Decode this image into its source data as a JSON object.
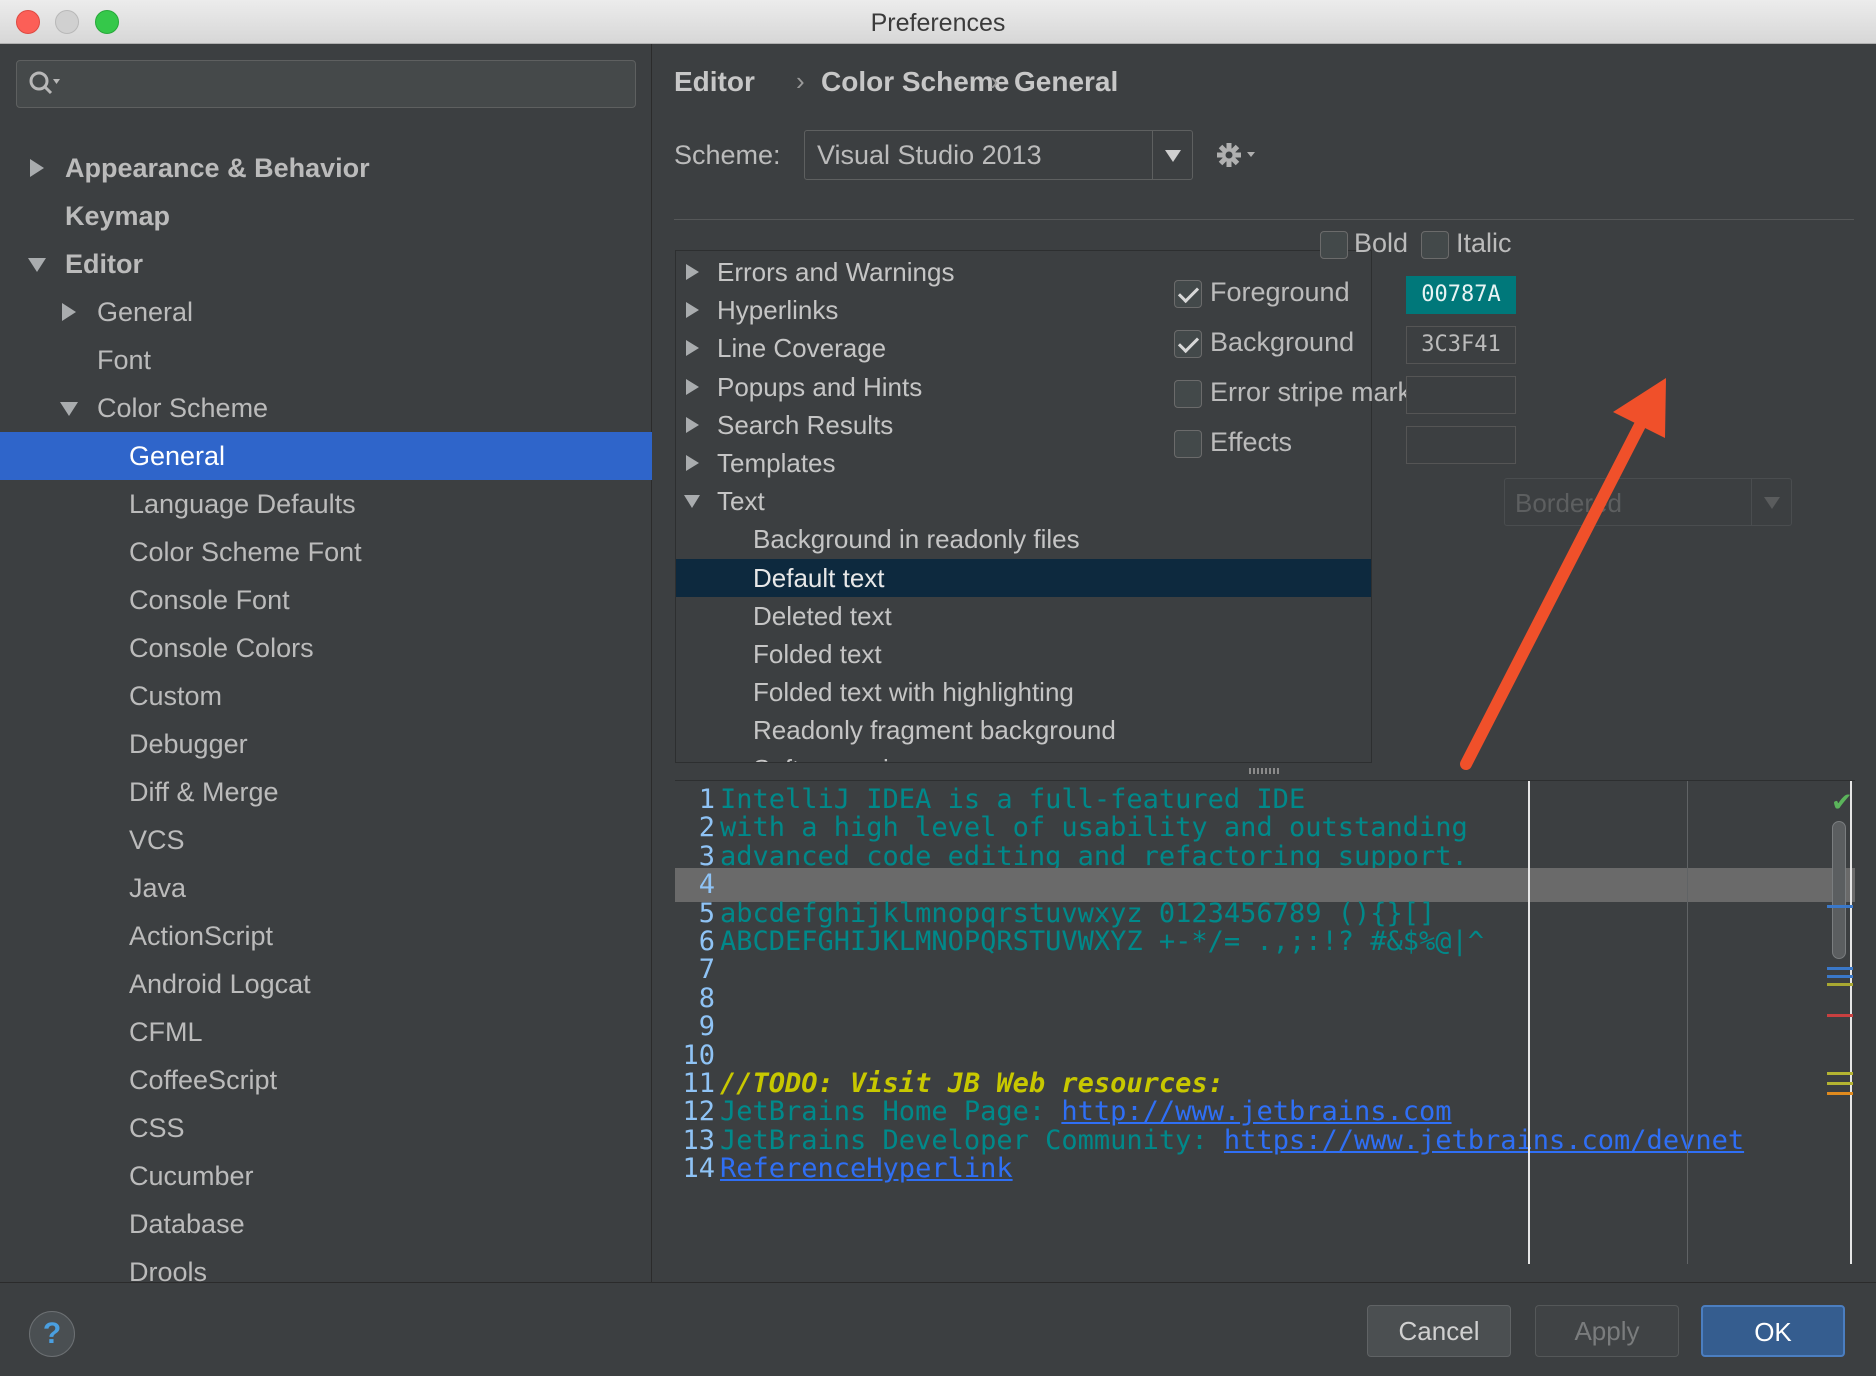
{
  "window": {
    "title": "Preferences"
  },
  "sidebar": {
    "search_placeholder": "",
    "items": [
      {
        "label": "Appearance & Behavior",
        "expand": "collapsed",
        "bold": true
      },
      {
        "label": "Keymap",
        "expand": "none",
        "bold": true
      },
      {
        "label": "Editor",
        "expand": "expanded",
        "bold": true
      },
      {
        "label": "General",
        "expand": "collapsed",
        "bold": false
      },
      {
        "label": "Font",
        "expand": "none",
        "bold": false
      },
      {
        "label": "Color Scheme",
        "expand": "expanded",
        "bold": false
      },
      {
        "label": "General",
        "expand": "none",
        "bold": false,
        "selected": true
      },
      {
        "label": "Language Defaults",
        "expand": "none",
        "bold": false
      },
      {
        "label": "Color Scheme Font",
        "expand": "none",
        "bold": false
      },
      {
        "label": "Console Font",
        "expand": "none",
        "bold": false
      },
      {
        "label": "Console Colors",
        "expand": "none",
        "bold": false
      },
      {
        "label": "Custom",
        "expand": "none",
        "bold": false
      },
      {
        "label": "Debugger",
        "expand": "none",
        "bold": false
      },
      {
        "label": "Diff & Merge",
        "expand": "none",
        "bold": false
      },
      {
        "label": "VCS",
        "expand": "none",
        "bold": false
      },
      {
        "label": "Java",
        "expand": "none",
        "bold": false
      },
      {
        "label": "ActionScript",
        "expand": "none",
        "bold": false
      },
      {
        "label": "Android Logcat",
        "expand": "none",
        "bold": false
      },
      {
        "label": "CFML",
        "expand": "none",
        "bold": false
      },
      {
        "label": "CoffeeScript",
        "expand": "none",
        "bold": false
      },
      {
        "label": "CSS",
        "expand": "none",
        "bold": false
      },
      {
        "label": "Cucumber",
        "expand": "none",
        "bold": false
      },
      {
        "label": "Database",
        "expand": "none",
        "bold": false
      },
      {
        "label": "Drools",
        "expand": "none",
        "bold": false
      }
    ]
  },
  "breadcrumb": [
    "Editor",
    "Color Scheme",
    "General"
  ],
  "scheme": {
    "label": "Scheme:",
    "value": "Visual Studio 2013"
  },
  "element_tree": [
    {
      "label": "Errors and Warnings",
      "expand": "collapsed"
    },
    {
      "label": "Hyperlinks",
      "expand": "collapsed"
    },
    {
      "label": "Line Coverage",
      "expand": "collapsed"
    },
    {
      "label": "Popups and Hints",
      "expand": "collapsed"
    },
    {
      "label": "Search Results",
      "expand": "collapsed"
    },
    {
      "label": "Templates",
      "expand": "collapsed"
    },
    {
      "label": "Text",
      "expand": "expanded"
    },
    {
      "label": "Background in readonly files",
      "expand": "none"
    },
    {
      "label": "Default text",
      "expand": "none",
      "selected": true
    },
    {
      "label": "Deleted text",
      "expand": "none"
    },
    {
      "label": "Folded text",
      "expand": "none"
    },
    {
      "label": "Folded text with highlighting",
      "expand": "none"
    },
    {
      "label": "Readonly fragment background",
      "expand": "none"
    },
    {
      "label": "Soft wrap sign",
      "expand": "none"
    }
  ],
  "attributes": {
    "bold": {
      "label": "Bold",
      "checked": false
    },
    "italic": {
      "label": "Italic",
      "checked": false
    },
    "foreground": {
      "label": "Foreground",
      "checked": true,
      "value": "00787A",
      "color": "#00787A"
    },
    "background": {
      "label": "Background",
      "checked": true,
      "value": "3C3F41",
      "color": "#3C3F41"
    },
    "error_stripe": {
      "label": "Error stripe mark",
      "checked": false,
      "value": ""
    },
    "effects": {
      "label": "Effects",
      "checked": false,
      "value": ""
    },
    "effect_type": "Bordered"
  },
  "preview": {
    "lines": [
      {
        "n": "1",
        "text": "IntelliJ IDEA is a full-featured IDE",
        "style": "default"
      },
      {
        "n": "2",
        "text": "with a high level of usability and outstanding",
        "style": "default"
      },
      {
        "n": "3",
        "text": "advanced code editing and refactoring support.",
        "style": "default"
      },
      {
        "n": "4",
        "text": "",
        "style": "current"
      },
      {
        "n": "5",
        "text": "abcdefghijklmnopqrstuvwxyz 0123456789 (){}[]",
        "style": "default"
      },
      {
        "n": "6",
        "text": "ABCDEFGHIJKLMNOPQRSTUVWXYZ +-*/= .,;:!? #&$%@|^",
        "style": "default"
      },
      {
        "n": "7",
        "text": "",
        "style": "default"
      },
      {
        "n": "8",
        "text": "",
        "style": "default"
      },
      {
        "n": "9",
        "text": "",
        "style": "default"
      },
      {
        "n": "10",
        "text": "",
        "style": "default"
      },
      {
        "n": "11",
        "text": "//TODO: Visit JB Web resources:",
        "style": "todo"
      },
      {
        "n": "12",
        "text": "JetBrains Home Page: ",
        "link": "http://www.jetbrains.com",
        "style": "link"
      },
      {
        "n": "13",
        "text": "JetBrains Developer Community: ",
        "link": "https://www.jetbrains.com/devnet",
        "style": "link"
      },
      {
        "n": "14",
        "text": "",
        "link": "ReferenceHyperlink",
        "style": "link"
      }
    ],
    "marker_colors": [
      "#3a78c9",
      "#3a78c9",
      "#3a78c9",
      "#a8a832",
      "#c84040",
      "#b4b432",
      "#b4b432",
      "#e08a1e"
    ]
  },
  "buttons": {
    "help": "?",
    "cancel": "Cancel",
    "apply": "Apply",
    "ok": "OK"
  },
  "colors": {
    "accent": "#2F65CA",
    "arrow": "#F0502A"
  }
}
